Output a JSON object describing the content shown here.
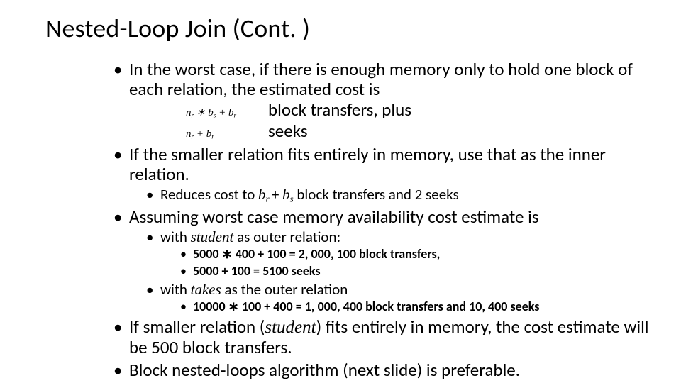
{
  "title": "Nested-Loop Join (Cont. )",
  "b1": {
    "text": "In the worst case, if there is enough memory only to hold one block of each relation, the estimated cost is",
    "f1_desc": "block transfers, plus",
    "f2_desc": "seeks"
  },
  "b2": {
    "text": "If the smaller relation fits entirely in memory, use that as the inner relation.",
    "s1_a": "Reduces cost to ",
    "s1_b": " block transfers and 2 seeks"
  },
  "b3": {
    "text": "Assuming worst case memory availability cost estimate is",
    "s1": {
      "a": "with ",
      "b": "student",
      "c": " as outer relation:"
    },
    "s1s1": "5000 ∗ 400 + 100 = 2, 000, 100 block transfers,",
    "s1s2": "5000 + 100 = 5100 seeks",
    "s2": {
      "a": "with ",
      "b": "takes",
      "c": "  as the outer relation"
    },
    "s2s1": "10000 ∗ 100 + 400 = 1, 000, 400 block transfers and 10, 400 seeks"
  },
  "b4": {
    "a": "If smaller relation (",
    "b": "student",
    "c": ") fits entirely in memory, the cost estimate will be 500 block transfers."
  },
  "b5": "Block nested-loops algorithm (next slide) is preferable."
}
